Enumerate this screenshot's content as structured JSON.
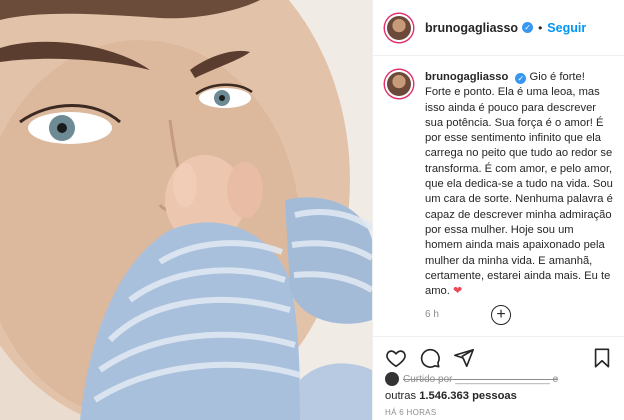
{
  "post": {
    "username": "brunogagliasso",
    "verified_mark": "✓",
    "separator": "•",
    "follow_label": "Seguir",
    "caption_text": "Gio é forte! Forte e ponto. Ela é uma leoa, mas isso ainda é pouco para descrever sua potência. Sua força é o amor! É por esse sentimento infinito que ela carrega no peito que tudo ao redor se transforma. É com amor, e pelo amor, que ela dedica-se a tudo na vida. Sou um cara de sorte. Nenhuma palavra é capaz de descrever minha admiração por essa mulher. Hoje sou um homem ainda mais apaixonado pela mulher da minha vida. E amanhã, certamente, estarei ainda mais. Eu te amo.",
    "caption_heart": "❤",
    "time_ago": "6 h",
    "add_comment_symbol": "+",
    "liked_by_text": "Curtido por _________________ e",
    "others_prefix": "outras",
    "others_count": "1.546.363 pessoas",
    "posted_when": "HÁ 6 HORAS"
  },
  "icons": {
    "like": "heart-outline-icon",
    "comment": "comment-icon",
    "share": "paper-plane-icon",
    "save": "bookmark-icon"
  },
  "colors": {
    "link_blue": "#0095f6",
    "verified_blue": "#3897f0",
    "heart_red": "#ed4956",
    "muted_gray": "#8e8e8e"
  }
}
